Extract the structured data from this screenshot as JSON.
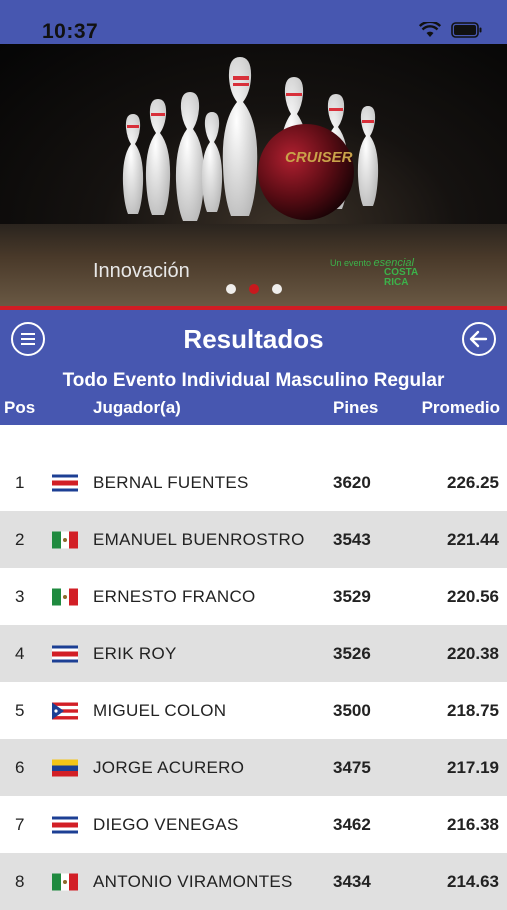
{
  "status": {
    "time": "10:37"
  },
  "banner": {
    "caption": "Innovación",
    "logo_line1": "Un evento",
    "logo_line2": "esencial",
    "logo_line3": "COSTA",
    "logo_line4": "RICA",
    "ball_text": "CRUISER"
  },
  "header": {
    "title": "Resultados",
    "subtitle": "Todo Evento Individual Masculino Regular"
  },
  "columns": {
    "pos": "Pos",
    "player": "Jugador(a)",
    "pins": "Pines",
    "average": "Promedio"
  },
  "rows": [
    {
      "pos": "1",
      "country": "Costa Rica",
      "name": "BERNAL FUENTES",
      "pins": "3620",
      "avg": "226.25"
    },
    {
      "pos": "2",
      "country": "Mexico",
      "name": "EMANUEL BUENROSTRO",
      "pins": "3543",
      "avg": "221.44"
    },
    {
      "pos": "3",
      "country": "Mexico",
      "name": "ERNESTO FRANCO",
      "pins": "3529",
      "avg": "220.56"
    },
    {
      "pos": "4",
      "country": "Costa Rica",
      "name": "ERIK ROY",
      "pins": "3526",
      "avg": "220.38"
    },
    {
      "pos": "5",
      "country": "Puerto Rico",
      "name": "MIGUEL COLON",
      "pins": "3500",
      "avg": "218.75"
    },
    {
      "pos": "6",
      "country": "Venezuela",
      "name": "JORGE ACURERO",
      "pins": "3475",
      "avg": "217.19"
    },
    {
      "pos": "7",
      "country": "Costa Rica",
      "name": "DIEGO VENEGAS",
      "pins": "3462",
      "avg": "216.38"
    },
    {
      "pos": "8",
      "country": "Mexico",
      "name": "ANTONIO VIRAMONTES",
      "pins": "3434",
      "avg": "214.63"
    }
  ]
}
